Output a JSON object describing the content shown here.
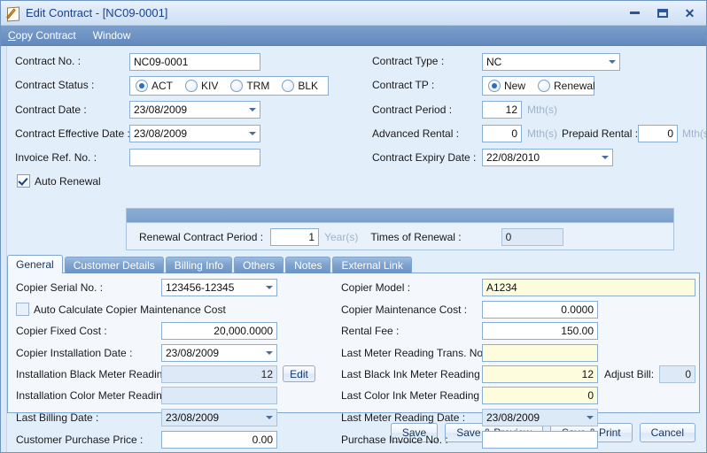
{
  "window": {
    "title": "Edit Contract - [NC09-0001]",
    "icon": "edit-document-icon",
    "minimize": "–",
    "maximize": "□",
    "close": "✕"
  },
  "menubar": {
    "items": [
      {
        "label": "Copy Contract",
        "accel": "C"
      },
      {
        "label": "Window",
        "accel": ""
      }
    ]
  },
  "header": {
    "contract_no": {
      "label": "Contract No. :",
      "value": "NC09-0001"
    },
    "contract_status": {
      "label": "Contract Status :",
      "options": [
        "ACT",
        "KIV",
        "TRM",
        "BLK"
      ],
      "selected": "ACT"
    },
    "contract_date": {
      "label": "Contract Date :",
      "value": "23/08/2009"
    },
    "contract_effective_date": {
      "label": "Contract Effective Date :",
      "value": "23/08/2009"
    },
    "invoice_ref_no": {
      "label": "Invoice Ref. No. :",
      "value": ""
    },
    "auto_renewal": {
      "label": "Auto Renewal",
      "checked": true
    },
    "contract_type": {
      "label": "Contract Type :",
      "value": "NC"
    },
    "contract_tp": {
      "label": "Contract TP :",
      "options": [
        "New",
        "Renewal"
      ],
      "selected": "New"
    },
    "contract_period": {
      "label": "Contract Period :",
      "value": "12",
      "unit": "Mth(s)"
    },
    "advanced_rental": {
      "label": "Advanced Rental :",
      "value": "0",
      "unit": "Mth(s)"
    },
    "prepaid_rental": {
      "label": "Prepaid Rental :",
      "value": "0",
      "unit": "Mth(s)"
    },
    "contract_expiry_date": {
      "label": "Contract Expiry Date :",
      "value": "22/08/2010"
    },
    "renewal_contract_period": {
      "label": "Renewal Contract Period :",
      "value": "1",
      "unit": "Year(s)"
    },
    "times_of_renewal": {
      "label": "Times of Renewal :",
      "value": "0"
    }
  },
  "tabs": {
    "items": [
      {
        "label": "General",
        "active": true
      },
      {
        "label": "Customer Details",
        "active": false
      },
      {
        "label": "Billing Info",
        "active": false
      },
      {
        "label": "Others",
        "active": false
      },
      {
        "label": "Notes",
        "active": false
      },
      {
        "label": "External Link",
        "active": false
      }
    ]
  },
  "general_tab": {
    "copier_serial_no": {
      "label": "Copier Serial No. :",
      "value": "123456-12345"
    },
    "auto_calculate_maintenance": {
      "label": "Auto Calculate Copier Maintenance Cost",
      "checked": false
    },
    "copier_fixed_cost": {
      "label": "Copier Fixed Cost :",
      "value": "20,000.0000"
    },
    "copier_installation_date": {
      "label": "Copier Installation Date :",
      "value": "23/08/2009"
    },
    "installation_black_meter_reading": {
      "label": "Installation Black Meter Reading",
      "value": "12"
    },
    "edit_button": {
      "label": "Edit"
    },
    "installation_color_meter_reading": {
      "label": "Installation Color Meter Reading",
      "value": ""
    },
    "last_billing_date": {
      "label": "Last Billing Date :",
      "value": "23/08/2009"
    },
    "customer_purchase_price": {
      "label": "Customer Purchase Price :",
      "value": "0.00"
    },
    "copier_model": {
      "label": "Copier Model :",
      "value": "A1234"
    },
    "copier_maintenance_cost": {
      "label": "Copier Maintenance Cost :",
      "value": "0.0000"
    },
    "rental_fee": {
      "label": "Rental Fee :",
      "value": "150.00"
    },
    "last_meter_reading_trans_no": {
      "label": "Last Meter Reading Trans. No. :",
      "value": ""
    },
    "last_black_ink_meter_reading": {
      "label": "Last Black Ink Meter Reading :",
      "value": "12"
    },
    "adjust_bill": {
      "label": "Adjust  Bill:",
      "value": "0"
    },
    "last_color_ink_meter_reading": {
      "label": "Last Color Ink Meter Reading :",
      "value": "0"
    },
    "last_meter_reading_date": {
      "label": "Last Meter Reading Date :",
      "value": "23/08/2009"
    },
    "purchase_invoice_no": {
      "label": "Purchase Invoice No. :",
      "value": ""
    }
  },
  "footer": {
    "buttons": [
      {
        "label": "Save"
      },
      {
        "label": "Save & Preview"
      },
      {
        "label": "Save & Print"
      },
      {
        "label": "Cancel"
      }
    ]
  },
  "colors": {
    "titlebar_text": "#19418c",
    "menubar_bg": "#6f94c4",
    "field_border": "#8aaed4",
    "yellow_field": "#fdfcdc",
    "panel_bg": "#f4f8fd",
    "window_bg": "#e3eefb"
  }
}
